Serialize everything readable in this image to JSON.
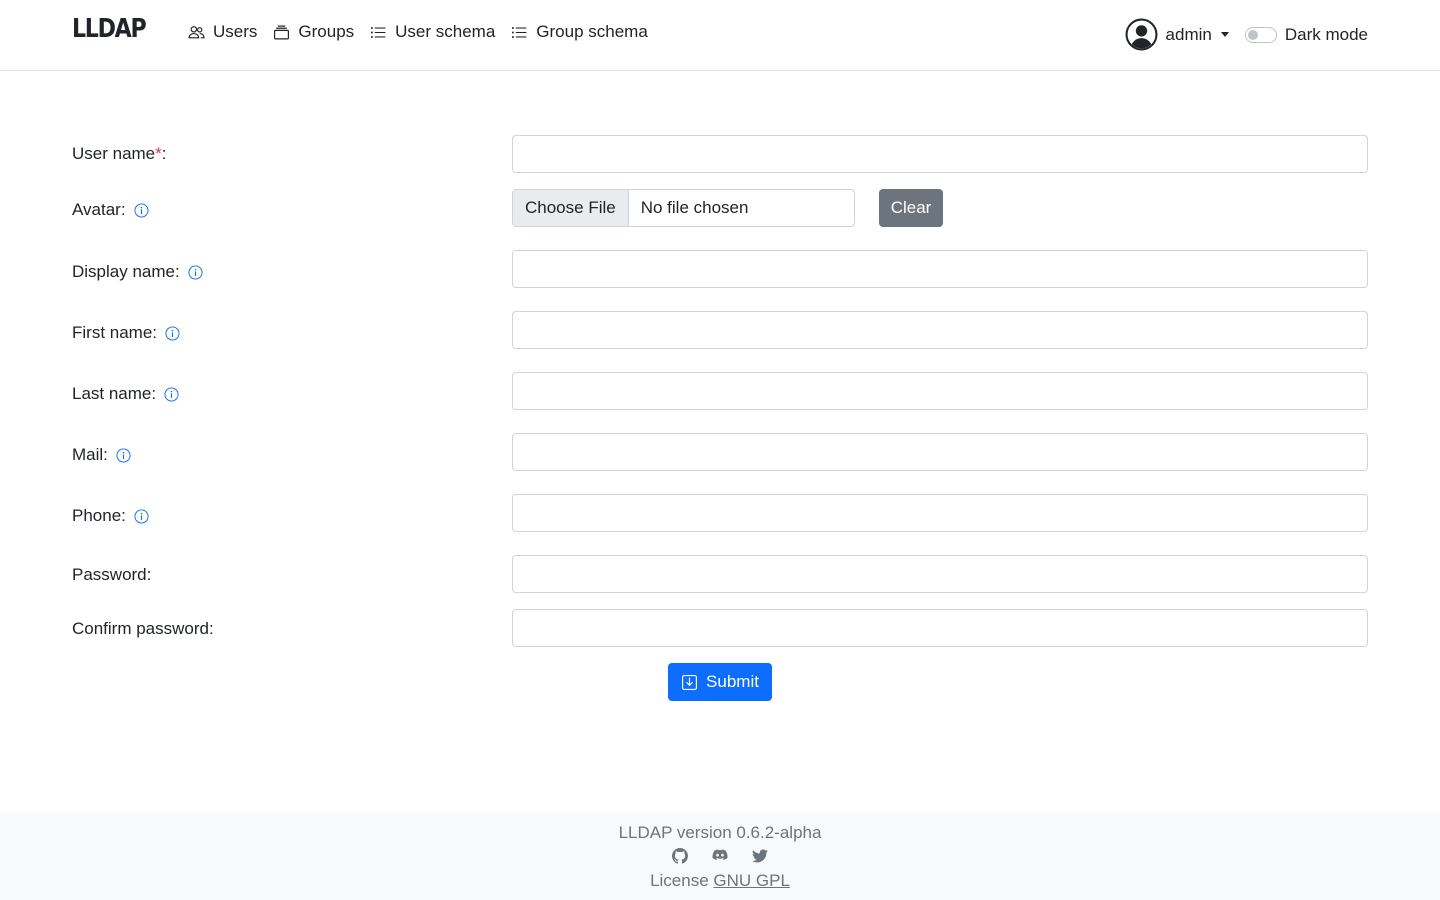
{
  "brand": "LLDAP",
  "nav": {
    "users": "Users",
    "groups": "Groups",
    "user_schema": "User schema",
    "group_schema": "Group schema"
  },
  "user_menu": {
    "name": "admin"
  },
  "dark_mode": {
    "label": "Dark mode",
    "enabled": false
  },
  "form": {
    "username": {
      "label": "User name",
      "required_mark": "*",
      "suffix": ":",
      "value": ""
    },
    "avatar": {
      "label": "Avatar:",
      "choose_label": "Choose File",
      "file_status": "No file chosen",
      "clear_label": "Clear"
    },
    "display_name": {
      "label": "Display name:",
      "value": ""
    },
    "first_name": {
      "label": "First name:",
      "value": ""
    },
    "last_name": {
      "label": "Last name:",
      "value": ""
    },
    "mail": {
      "label": "Mail:",
      "value": ""
    },
    "phone": {
      "label": "Phone:",
      "value": ""
    },
    "password": {
      "label": "Password:",
      "value": ""
    },
    "confirm_password": {
      "label": "Confirm password:",
      "value": ""
    },
    "submit_label": "Submit"
  },
  "footer": {
    "version": "LLDAP version 0.6.2-alpha",
    "license_prefix": "License ",
    "license_link": "GNU GPL",
    "socials": [
      "github-icon",
      "discord-icon",
      "twitter-icon"
    ]
  },
  "colors": {
    "primary": "#0d6efd",
    "secondary": "#6c757d",
    "required": "#dc3545",
    "info_icon": "#0d6efd",
    "footer_bg": "#f8f9fa"
  }
}
